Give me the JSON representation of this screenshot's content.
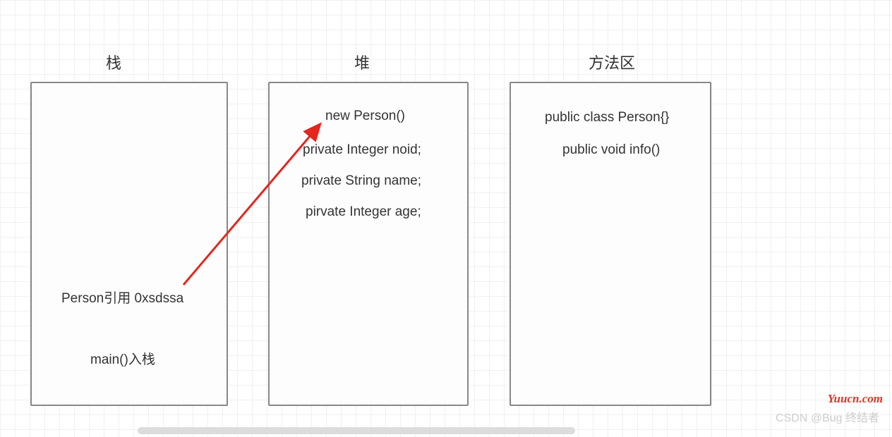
{
  "titles": {
    "stack": "栈",
    "heap": "堆",
    "method_area": "方法区"
  },
  "stack": {
    "ref": "Person引用 0xsdssa",
    "main": "main()入栈"
  },
  "heap": {
    "new": "new Person()",
    "f1": "private Integer noid;",
    "f2": "private String name;",
    "f3": "pirvate Integer age;"
  },
  "method_area": {
    "c1": "public class Person{}",
    "c2": "public void info()"
  },
  "watermarks": {
    "csdn": "CSDN @Bug 终结者",
    "yuucn": "Yuucn.com"
  }
}
